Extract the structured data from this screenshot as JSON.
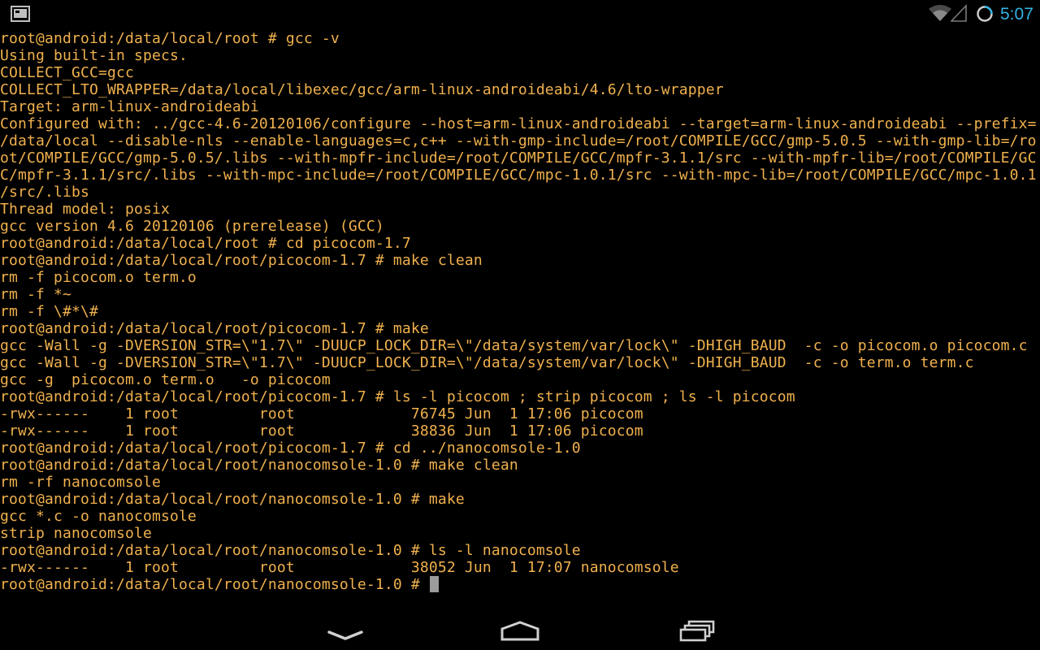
{
  "status_bar": {
    "time": "5:07",
    "icons": [
      "terminal-notification-icon",
      "wifi-icon",
      "signal-icon",
      "sync-icon"
    ],
    "accent_color": "#33b5e5"
  },
  "terminal": {
    "text_color": "#f0b14d",
    "background": "#000000",
    "cursor_color": "#9b9b9b",
    "lines": [
      "root@android:/data/local/root # gcc -v",
      "Using built-in specs.",
      "COLLECT_GCC=gcc",
      "COLLECT_LTO_WRAPPER=/data/local/libexec/gcc/arm-linux-androideabi/4.6/lto-wrapper",
      "Target: arm-linux-androideabi",
      "Configured with: ../gcc-4.6-20120106/configure --host=arm-linux-androideabi --target=arm-linux-androideabi --prefix=",
      "/data/local --disable-nls --enable-languages=c,c++ --with-gmp-include=/root/COMPILE/GCC/gmp-5.0.5 --with-gmp-lib=/ro",
      "ot/COMPILE/GCC/gmp-5.0.5/.libs --with-mpfr-include=/root/COMPILE/GCC/mpfr-3.1.1/src --with-mpfr-lib=/root/COMPILE/GC",
      "C/mpfr-3.1.1/src/.libs --with-mpc-include=/root/COMPILE/GCC/mpc-1.0.1/src --with-mpc-lib=/root/COMPILE/GCC/mpc-1.0.1",
      "/src/.libs",
      "Thread model: posix",
      "gcc version 4.6 20120106 (prerelease) (GCC)",
      "root@android:/data/local/root # cd picocom-1.7",
      "root@android:/data/local/root/picocom-1.7 # make clean",
      "rm -f picocom.o term.o",
      "rm -f *~",
      "rm -f \\#*\\#",
      "root@android:/data/local/root/picocom-1.7 # make",
      "gcc -Wall -g -DVERSION_STR=\\\"1.7\\\" -DUUCP_LOCK_DIR=\\\"/data/system/var/lock\\\" -DHIGH_BAUD  -c -o picocom.o picocom.c",
      "gcc -Wall -g -DVERSION_STR=\\\"1.7\\\" -DUUCP_LOCK_DIR=\\\"/data/system/var/lock\\\" -DHIGH_BAUD  -c -o term.o term.c",
      "gcc -g  picocom.o term.o   -o picocom",
      "root@android:/data/local/root/picocom-1.7 # ls -l picocom ; strip picocom ; ls -l picocom",
      "-rwx------    1 root         root             76745 Jun  1 17:06 picocom",
      "-rwx------    1 root         root             38836 Jun  1 17:06 picocom",
      "root@android:/data/local/root/picocom-1.7 # cd ../nanocomsole-1.0",
      "root@android:/data/local/root/nanocomsole-1.0 # make clean",
      "rm -rf nanocomsole",
      "root@android:/data/local/root/nanocomsole-1.0 # make",
      "gcc *.c -o nanocomsole",
      "strip nanocomsole",
      "root@android:/data/local/root/nanocomsole-1.0 # ls -l nanocomsole",
      "-rwx------    1 root         root             38052 Jun  1 17:07 nanocomsole"
    ],
    "prompt": "root@android:/data/local/root/nanocomsole-1.0 # "
  },
  "nav_bar": {
    "buttons": [
      "back-button",
      "home-button",
      "recent-apps-button"
    ]
  }
}
